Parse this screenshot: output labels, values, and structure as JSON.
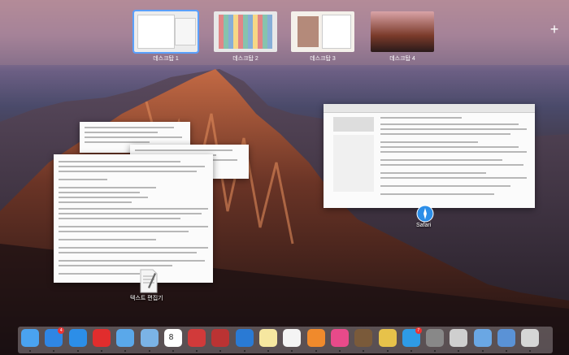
{
  "spaces": [
    {
      "label": "데스크탑 1",
      "active": true
    },
    {
      "label": "데스크탑 2",
      "active": false
    },
    {
      "label": "데스크탑 3",
      "active": false
    },
    {
      "label": "데스크탑 4",
      "active": false
    }
  ],
  "add_space_symbol": "+",
  "windows": {
    "text_editor_label": "텍스트 편집기",
    "safari_label": "Safari"
  },
  "colors": {
    "accent": "#5aa0ff",
    "badge": "#e33333"
  },
  "dock": {
    "items": [
      {
        "name": "finder-icon"
      },
      {
        "name": "app-store-icon",
        "badge": "4"
      },
      {
        "name": "safari-icon"
      },
      {
        "name": "opera-icon"
      },
      {
        "name": "mail-icon"
      },
      {
        "name": "preview-icon"
      },
      {
        "name": "calendar-icon",
        "day": "8"
      },
      {
        "name": "reeder-icon"
      },
      {
        "name": "reeder2-icon"
      },
      {
        "name": "cloud-icon"
      },
      {
        "name": "notes-icon"
      },
      {
        "name": "textedit-icon"
      },
      {
        "name": "pages-icon"
      },
      {
        "name": "music-icon"
      },
      {
        "name": "launchpad-icon"
      },
      {
        "name": "photos-icon"
      },
      {
        "name": "messages-icon",
        "badge": "7"
      },
      {
        "name": "system-prefs-icon"
      },
      {
        "name": "preview2-icon"
      },
      {
        "name": "folder-icon"
      },
      {
        "name": "folder2-icon"
      },
      {
        "name": "trash-icon"
      }
    ]
  }
}
